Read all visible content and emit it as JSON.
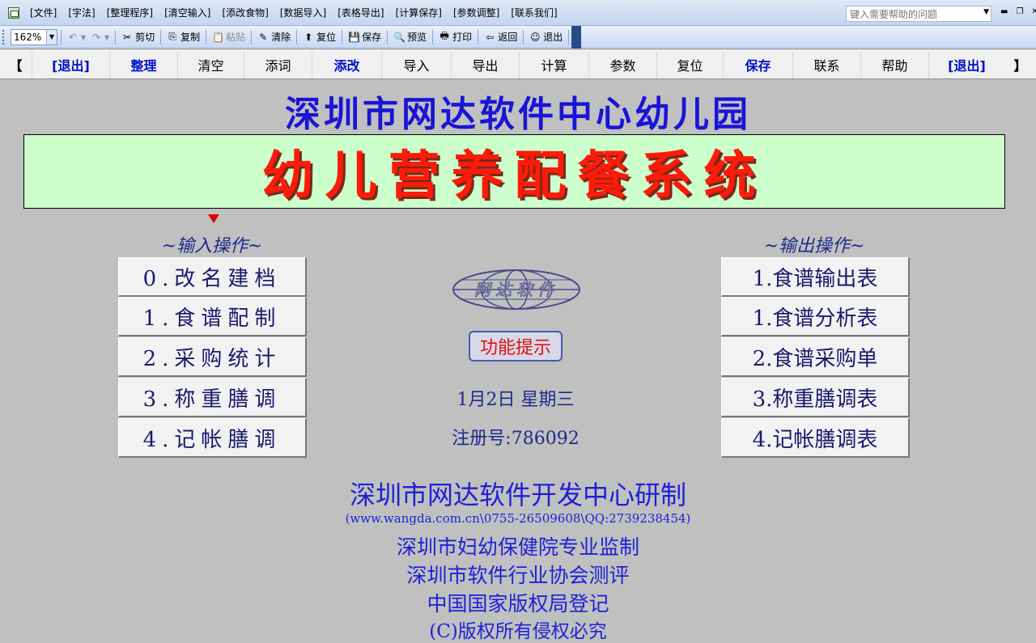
{
  "menu": {
    "items": [
      "[文件]",
      "[字法]",
      "[整理程序]",
      "[清空输入]",
      "[添改食物]",
      "[数据导入]",
      "[表格导出]",
      "[计算保存]",
      "[参数调整]",
      "[联系我们]"
    ],
    "help_placeholder": "键入需要帮助的问题"
  },
  "toolbar": {
    "zoom": "162%",
    "buttons": [
      {
        "label": "剪切",
        "icon": "scissors-icon",
        "glyph": "✂"
      },
      {
        "label": "复制",
        "icon": "copy-icon",
        "glyph": "⎘"
      },
      {
        "label": "粘贴",
        "icon": "paste-icon",
        "glyph": "📋",
        "disabled": true
      },
      {
        "label": "清除",
        "icon": "eraser-icon",
        "glyph": "✎"
      },
      {
        "label": "复位",
        "icon": "reset-icon",
        "glyph": "⬆"
      },
      {
        "label": "保存",
        "icon": "save-icon",
        "glyph": "💾"
      },
      {
        "label": "预览",
        "icon": "preview-icon",
        "glyph": "🔍"
      },
      {
        "label": "打印",
        "icon": "print-icon",
        "glyph": "🖶"
      },
      {
        "label": "返回",
        "icon": "back-arrow-icon",
        "glyph": "⇦"
      },
      {
        "label": "退出",
        "icon": "smiley-icon",
        "glyph": "☺"
      }
    ]
  },
  "nav": {
    "left_bracket": "【",
    "right_bracket": "】",
    "items": [
      {
        "label": "[退出]",
        "blue": true
      },
      {
        "label": "整理",
        "blue": true
      },
      {
        "label": "清空",
        "blue": false
      },
      {
        "label": "添词",
        "blue": false
      },
      {
        "label": "添改",
        "blue": true
      },
      {
        "label": "导入",
        "blue": false
      },
      {
        "label": "导出",
        "blue": false
      },
      {
        "label": "计算",
        "blue": false
      },
      {
        "label": "参数",
        "blue": false
      },
      {
        "label": "复位",
        "blue": false
      },
      {
        "label": "保存",
        "blue": true
      },
      {
        "label": "联系",
        "blue": false
      },
      {
        "label": "帮助",
        "blue": false
      },
      {
        "label": "[退出]",
        "blue": true
      }
    ]
  },
  "main": {
    "org_title": "深圳市网达软件中心幼儿园",
    "system_title": "幼儿营养配餐系统",
    "input_label": "~输入操作~",
    "output_label": "~输出操作~",
    "input_ops": [
      "0.改名建档",
      "1.食谱配制",
      "2.采购统计",
      "3.称重膳调",
      "4.记帐膳调"
    ],
    "output_ops": [
      "1.食谱输出表",
      "1.食谱分析表",
      "2.食谱采购单",
      "3.称重膳调表",
      "4.记帐膳调表"
    ],
    "logo_text": "网达软件",
    "hint_button": "功能提示",
    "date": "1月2日  星期三",
    "registration": "注册号:786092"
  },
  "footer": {
    "developer": "深圳市网达软件开发中心研制",
    "contact": "(www.wangda.com.cn\\0755-26509608\\QQ:2739238454)",
    "supervision": "深圳市妇幼保健院专业监制",
    "evaluation": "深圳市软件行业协会测评",
    "registration": "中国国家版权局登记",
    "copyright": "(C)版权所有侵权必究"
  }
}
